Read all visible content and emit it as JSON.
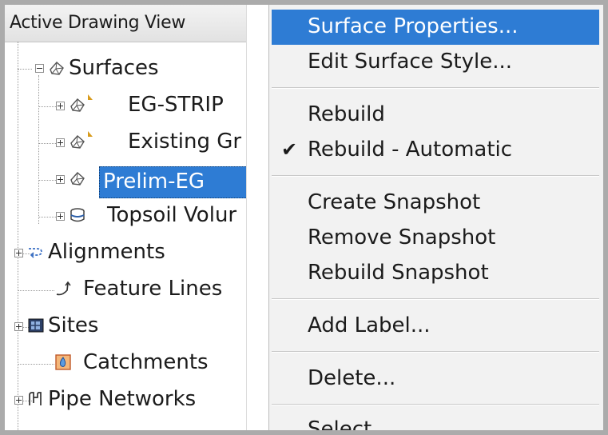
{
  "tree": {
    "header": "Active Drawing View",
    "items": [
      {
        "label": "Surfaces",
        "icon": "surface-icon"
      },
      {
        "label": "EG-STRIP",
        "icon": "surface-icon"
      },
      {
        "label": "Existing Gr",
        "icon": "surface-icon"
      },
      {
        "label": "Prelim-EG",
        "icon": "surface-icon",
        "selected": true
      },
      {
        "label": "Topsoil Volur",
        "icon": "volume-surface-icon"
      },
      {
        "label": "Alignments",
        "icon": "alignment-icon"
      },
      {
        "label": "Feature Lines",
        "icon": "feature-line-icon"
      },
      {
        "label": "Sites",
        "icon": "sites-icon"
      },
      {
        "label": "Catchments",
        "icon": "catchment-icon"
      },
      {
        "label": "Pipe Networks",
        "icon": "pipe-network-icon"
      }
    ]
  },
  "menu": {
    "items": [
      {
        "label": "Surface Properties...",
        "highlighted": true
      },
      {
        "label": "Edit Surface Style..."
      },
      {
        "label": "Rebuild"
      },
      {
        "label": "Rebuild - Automatic",
        "checked": true,
        "check_glyph": "✔"
      },
      {
        "label": "Create Snapshot"
      },
      {
        "label": "Remove Snapshot"
      },
      {
        "label": "Rebuild Snapshot"
      },
      {
        "label": "Add Label..."
      },
      {
        "label": "Delete..."
      },
      {
        "label": "Select"
      }
    ]
  },
  "colors": {
    "selection": "#2e7cd4",
    "menu_bg": "#f2f2f2",
    "frame": "#ababab"
  }
}
